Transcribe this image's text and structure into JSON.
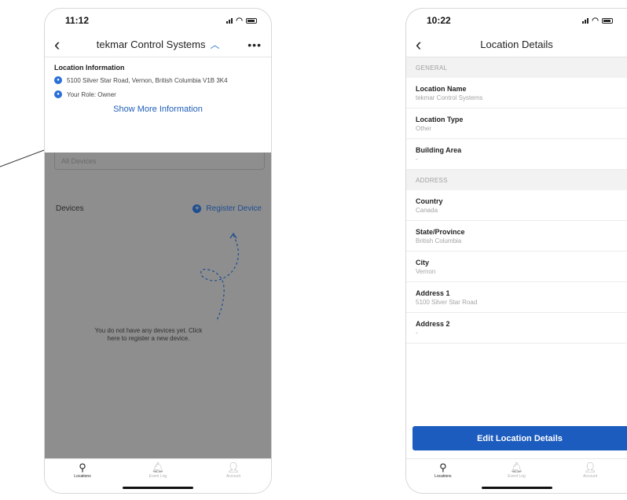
{
  "left_phone": {
    "status_time": "11:12",
    "nav_title": "tekmar Control Systems",
    "info_heading": "Location Information",
    "address": "5100 Silver Star Road, Vernon, British Columbia V1B 3K4",
    "role": "Your Role: Owner",
    "show_more": "Show More Information",
    "all_devices": "All Devices",
    "devices_label": "Devices",
    "register_label": "Register Device",
    "empty_message": "You do not have any devices yet. Click here to register a new device.",
    "tabs": [
      {
        "label": "Locations",
        "icon": "location-pin-icon"
      },
      {
        "label": "Event Log",
        "icon": "bell-icon"
      },
      {
        "label": "Account",
        "icon": "person-icon"
      }
    ]
  },
  "right_phone": {
    "status_time": "10:22",
    "nav_title": "Location Details",
    "general_header": "GENERAL",
    "address_header": "ADDRESS",
    "general_rows": [
      {
        "label": "Location Name",
        "value": "tekmar Control Systems"
      },
      {
        "label": "Location Type",
        "value": "Other"
      },
      {
        "label": "Building Area",
        "value": "-"
      }
    ],
    "address_rows": [
      {
        "label": "Country",
        "value": "Canada"
      },
      {
        "label": "State/Province",
        "value": "British Columbia"
      },
      {
        "label": "City",
        "value": "Vernon"
      },
      {
        "label": "Address 1",
        "value": "5100 Silver Star Road"
      },
      {
        "label": "Address 2",
        "value": "-"
      }
    ],
    "edit_button": "Edit Location Details",
    "tabs": [
      {
        "label": "Locations",
        "icon": "location-pin-icon"
      },
      {
        "label": "Event Log",
        "icon": "bell-icon"
      },
      {
        "label": "Account",
        "icon": "person-icon"
      }
    ]
  },
  "colors": {
    "accent": "#1d5cbf",
    "overlay": "#8e8e8e"
  }
}
